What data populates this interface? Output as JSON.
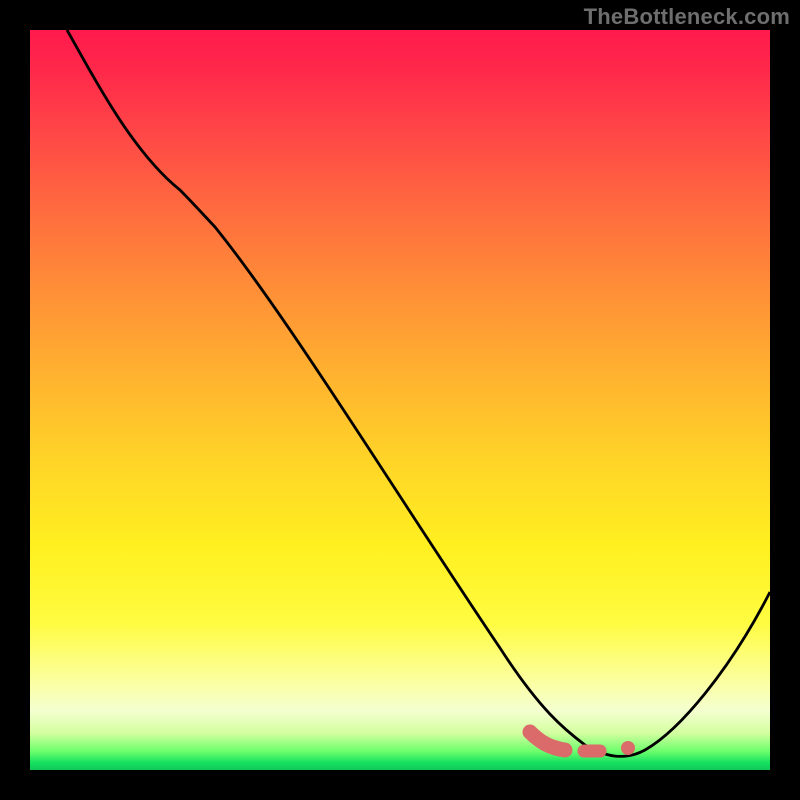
{
  "watermark": "TheBottleneck.com",
  "colors": {
    "curve": "#000000",
    "marker": "#db6a6a",
    "background_frame": "#000000"
  },
  "chart_data": {
    "type": "line",
    "title": "",
    "xlabel": "",
    "ylabel": "",
    "xlim": [
      0,
      100
    ],
    "ylim": [
      0,
      100
    ],
    "grid": false,
    "series": [
      {
        "name": "curve",
        "x": [
          5,
          10,
          20,
          25,
          30,
          40,
          50,
          60,
          65,
          70,
          75,
          80,
          85,
          100
        ],
        "values": [
          100,
          93,
          79,
          75,
          70,
          56,
          42.5,
          29,
          22.5,
          15,
          8,
          3,
          1.5,
          24
        ]
      }
    ],
    "markers": [
      {
        "name": "segment_a",
        "x_start": 67,
        "x_end": 72,
        "y": 2.8
      },
      {
        "name": "segment_b",
        "x_start": 74,
        "x_end": 76,
        "y": 2.6
      },
      {
        "name": "dot_c",
        "x": 79,
        "y": 2.9
      }
    ]
  }
}
